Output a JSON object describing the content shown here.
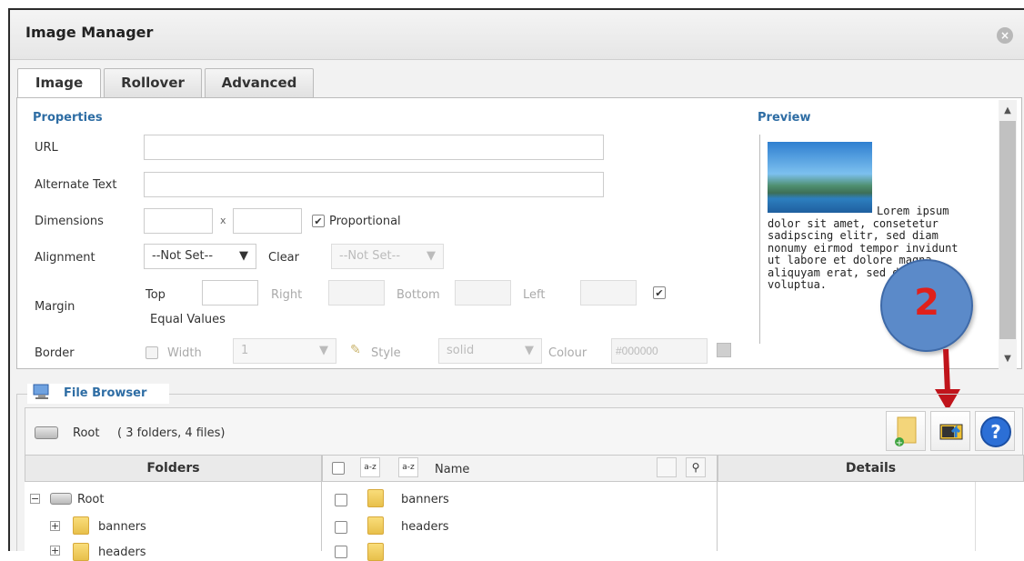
{
  "window": {
    "title": "Image Manager"
  },
  "tabs": [
    {
      "label": "Image",
      "active": true
    },
    {
      "label": "Rollover",
      "active": false
    },
    {
      "label": "Advanced",
      "active": false
    }
  ],
  "properties": {
    "title": "Properties",
    "url_label": "URL",
    "url_value": "",
    "alt_label": "Alternate Text",
    "alt_value": "",
    "dimensions_label": "Dimensions",
    "dim_sep": "x",
    "proportional_label": "Proportional",
    "proportional_checked": true,
    "alignment_label": "Alignment",
    "alignment_value": "--Not Set--",
    "clear_label": "Clear",
    "clear_value": "--Not Set--",
    "margin_label": "Margin",
    "margin_top": "Top",
    "margin_right": "Right",
    "margin_bottom": "Bottom",
    "margin_left": "Left",
    "equal_values_label": "Equal Values",
    "equal_values_checked": true,
    "border_label": "Border",
    "border_width_label": "Width",
    "border_width_value": "1",
    "border_style_label": "Style",
    "border_style_value": "solid",
    "border_colour_label": "Colour",
    "border_colour_value": "#000000"
  },
  "preview": {
    "title": "Preview",
    "text": "Lorem ipsum dolor sit amet, consetetur sadipscing elitr, sed diam nonumy eirmod tempor invidunt ut labore et dolore magna aliquyam erat, sed diam voluptua."
  },
  "file_browser": {
    "title": "File Browser",
    "path_name": "Root",
    "path_summary": "( 3 folders, 4 files)",
    "folders_header": "Folders",
    "name_header": "Name",
    "details_header": "Details",
    "tree": [
      {
        "label": "Root",
        "expander": "−"
      },
      {
        "label": "banners",
        "expander": "+"
      },
      {
        "label": "headers",
        "expander": "+"
      }
    ],
    "files": [
      "banners",
      "headers",
      ""
    ]
  },
  "annotation": {
    "number": "2",
    "color": "#5b8ac9",
    "number_color": "#e0201b",
    "arrow_color": "#c0141b"
  },
  "colors": {
    "accent": "#2e6da4",
    "help": "#2c6fd6"
  }
}
